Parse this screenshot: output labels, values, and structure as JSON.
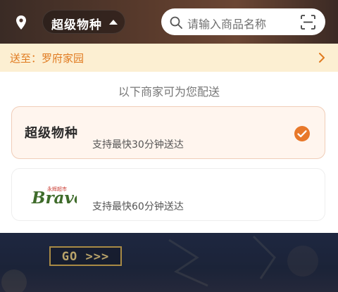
{
  "header": {
    "location_icon": "location-pin-icon",
    "brand_name": "超级物种",
    "caret_icon": "caret-up-icon",
    "search": {
      "placeholder": "请输入商品名称",
      "search_icon": "search-icon",
      "scan_icon": "scan-icon"
    }
  },
  "address_bar": {
    "text": "送至：罗府家园",
    "chevron_icon": "chevron-right-icon"
  },
  "sheet": {
    "title": "以下商家可为您配送",
    "stores": [
      {
        "logo_text": "超级物种",
        "desc": "支持最快30分钟送达",
        "selected": true
      },
      {
        "logo_text": "Bravo",
        "logo_sub": "永辉超市",
        "desc": "支持最快60分钟送达",
        "selected": false
      }
    ]
  },
  "banner": {
    "go_label": "GO >>>"
  },
  "colors": {
    "accent": "#E8782A",
    "address_bg": "#FCEFD2",
    "selected_card_bg": "#FFF5EE",
    "bravo_green": "#3E6B2A",
    "bravo_red": "#C8362C"
  }
}
